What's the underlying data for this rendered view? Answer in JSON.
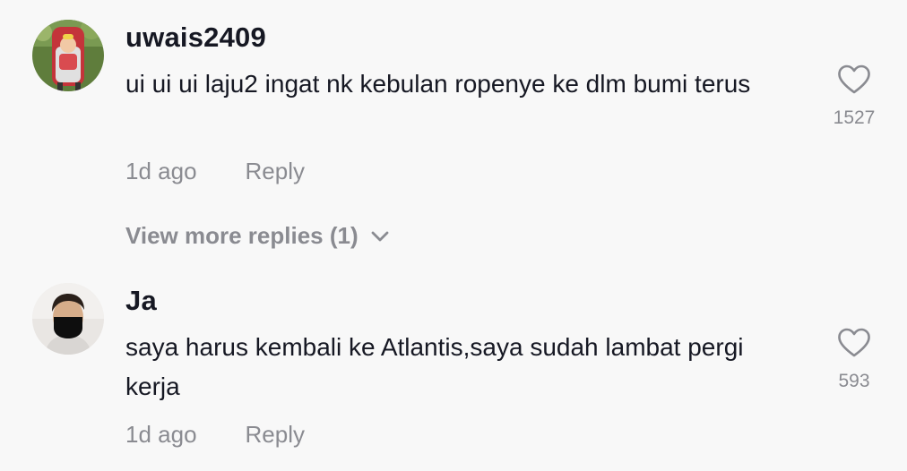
{
  "comments": [
    {
      "username": "uwais2409",
      "text": "ui ui ui laju2 ingat nk kebulan ropenye ke dlm bumi terus",
      "time": "1d ago",
      "reply_label": "Reply",
      "likes": "1527",
      "avatar": "baby-in-red-stroller-avatar"
    },
    {
      "username": "Ja",
      "text": "saya harus kembali ke Atlantis,saya sudah lambat pergi kerja",
      "time": "1d ago",
      "reply_label": "Reply",
      "likes": "593",
      "avatar": "man-with-black-mask-avatar"
    }
  ],
  "view_more_replies": "View more replies (1)",
  "colors": {
    "background": "#f8f8f8",
    "text_primary": "#161823",
    "text_secondary": "#8a8b91"
  }
}
